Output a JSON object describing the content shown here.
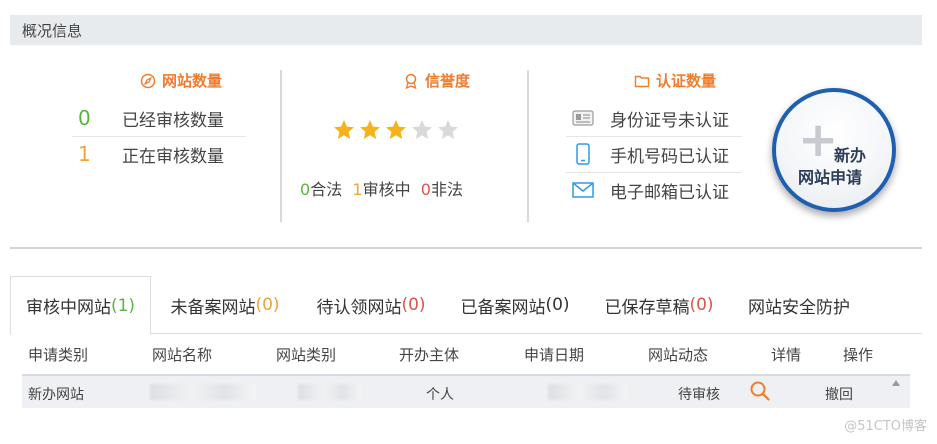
{
  "header": {
    "title": "概况信息"
  },
  "site_count": {
    "title": "网站数量",
    "icon": "compass-icon",
    "rows": [
      {
        "value": "0",
        "label": "已经审核数量",
        "color": "#5bb33f"
      },
      {
        "value": "1",
        "label": "正在审核数量",
        "color": "#f0a33a"
      }
    ]
  },
  "reputation": {
    "title": "信誉度",
    "icon": "award-icon",
    "rating": 3,
    "max_rating": 5,
    "counts": [
      {
        "value": "0",
        "label": "合法",
        "color": "#5bb33f"
      },
      {
        "value": "1",
        "label": "审核中",
        "color": "#f0a33a"
      },
      {
        "value": "0",
        "label": "非法",
        "color": "#e0534a"
      }
    ]
  },
  "auth": {
    "title": "认证数量",
    "icon": "folder-icon",
    "rows": [
      {
        "icon": "id-card-icon",
        "label": "身份证号未认证"
      },
      {
        "icon": "mobile-phone-icon",
        "label": "手机号码已认证"
      },
      {
        "icon": "email-icon",
        "label": "电子邮箱已认证"
      }
    ]
  },
  "apply_button": {
    "line1": "新办",
    "line2": "网站申请"
  },
  "tabs": [
    {
      "label": "审核中网站",
      "count": "(1)",
      "count_color": "#5bb33f",
      "active": true
    },
    {
      "label": "未备案网站",
      "count": "(0)",
      "count_color": "#f0a33a",
      "active": false
    },
    {
      "label": "待认领网站",
      "count": "(0)",
      "count_color": "#e0534a",
      "active": false
    },
    {
      "label": "已备案网站",
      "count": "(0)",
      "count_color": "#333333",
      "active": false
    },
    {
      "label": "已保存草稿",
      "count": "(0)",
      "count_color": "#e0534a",
      "active": false
    },
    {
      "label": "网站安全防护",
      "count": "",
      "count_color": "#333333",
      "active": false
    }
  ],
  "table": {
    "headers": [
      "申请类别",
      "网站名称",
      "网站类别",
      "开办主体",
      "申请日期",
      "网站动态",
      "详情",
      "操作"
    ],
    "rows": [
      {
        "apply_type": "新办网站",
        "site_name": "",
        "site_type": "",
        "owner": "个人",
        "apply_date": "",
        "status": "待审核",
        "action": "撤回"
      }
    ]
  },
  "watermark": "@51CTO博客"
}
